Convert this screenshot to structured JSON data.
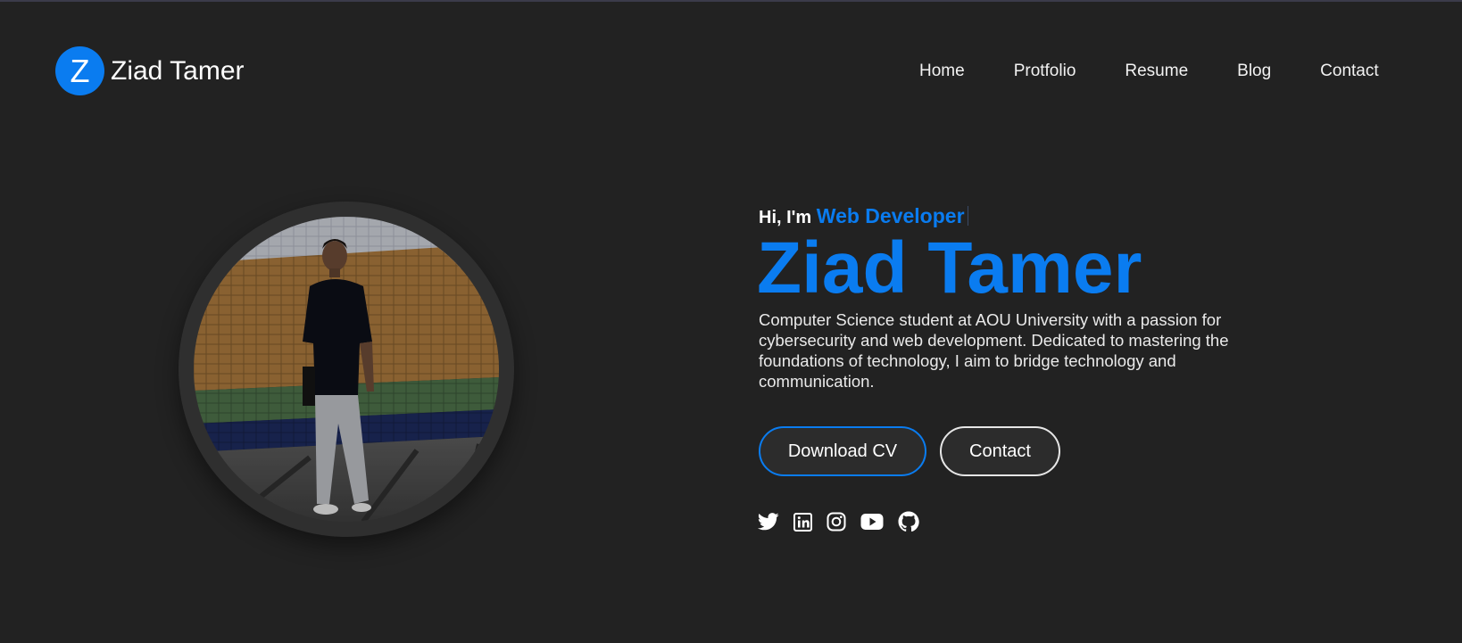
{
  "header": {
    "logo_letter": "Z",
    "logo_name": "Ziad Tamer",
    "nav": [
      {
        "label": "Home"
      },
      {
        "label": "Protfolio"
      },
      {
        "label": "Resume"
      },
      {
        "label": "Blog"
      },
      {
        "label": "Contact"
      }
    ]
  },
  "hero": {
    "greeting": "Hi, I'm",
    "role": "Web Developer",
    "name": "Ziad Tamer",
    "bio": "Computer Science student at AOU University with a passion for cybersecurity and web development. Dedicated to mastering the foundations of technology, I aim to bridge technology and communication.",
    "buttons": {
      "download_cv": "Download CV",
      "contact": "Contact"
    },
    "socials": [
      "twitter-icon",
      "linkedin-icon",
      "instagram-icon",
      "youtube-icon",
      "github-icon"
    ]
  },
  "colors": {
    "background": "#222222",
    "accent": "#0a7cf0",
    "text": "#ffffff"
  }
}
